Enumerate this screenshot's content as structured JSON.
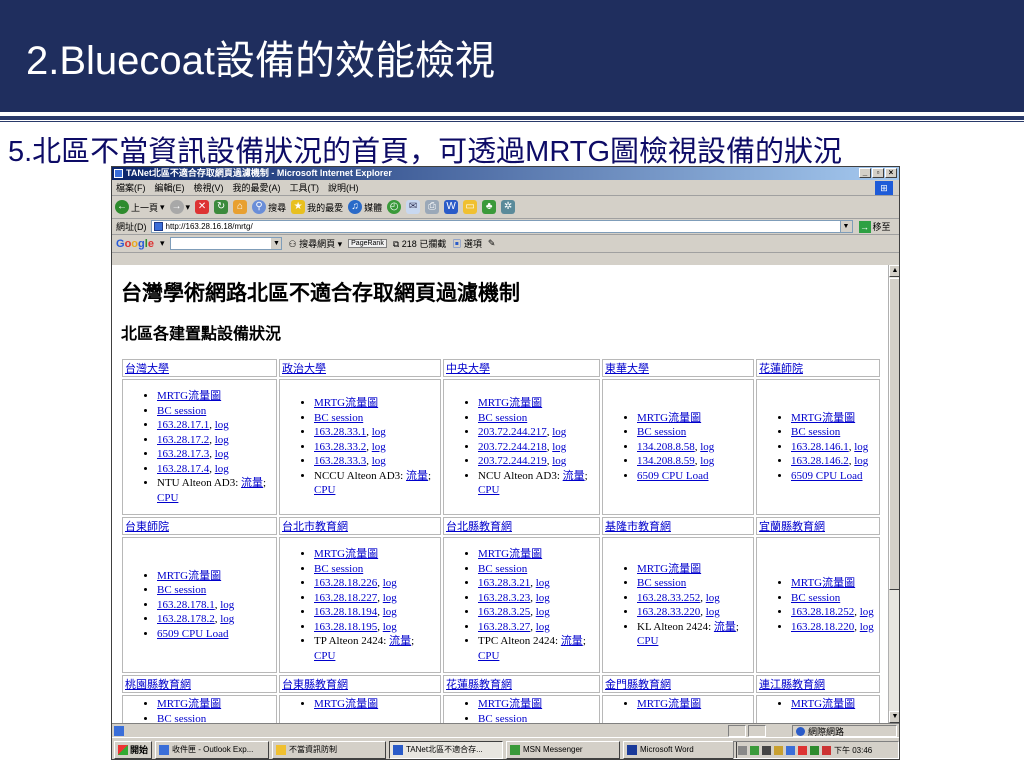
{
  "slide": {
    "title": "2.Bluecoat設備的效能檢視",
    "subtitle": "5.北區不當資訊設備狀況的首頁，可透過MRTG圖檢視設備的狀況"
  },
  "browser": {
    "window_title": "TANet北區不適合存取網頁過濾機制 - Microsoft Internet Explorer",
    "menu": [
      "檔案(F)",
      "編輯(E)",
      "檢視(V)",
      "我的最愛(A)",
      "工具(T)",
      "說明(H)"
    ],
    "toolbar": {
      "back": "上一頁",
      "search": "搜尋",
      "favorites": "我的最愛",
      "media": "媒體"
    },
    "address": {
      "label": "網址(D)",
      "url": "http://163.28.16.18/mrtg/",
      "go": "移至"
    },
    "google_bar": {
      "logo": "Google",
      "search_web": "搜尋網頁",
      "pagerank": "PageRank",
      "blocked": "218 已攔截",
      "options": "選項"
    },
    "status": {
      "zone": "網際網路"
    }
  },
  "page": {
    "h1": "台灣學術網路北區不適合存取網頁過濾機制",
    "h2": "北區各建置點設備狀況",
    "rows": [
      {
        "headers": [
          "台灣大學",
          "政治大學",
          "中央大學",
          "東華大學",
          "花蓮師院"
        ],
        "cells": [
          [
            {
              "t": "",
              "links": [
                "MRTG流量圖"
              ]
            },
            {
              "t": "",
              "links": [
                "BC session"
              ]
            },
            {
              "t": ", ",
              "links": [
                "163.28.17.1",
                "log"
              ]
            },
            {
              "t": ", ",
              "links": [
                "163.28.17.2",
                "log"
              ]
            },
            {
              "t": ", ",
              "links": [
                "163.28.17.3",
                "log"
              ]
            },
            {
              "t": ", ",
              "links": [
                "163.28.17.4",
                "log"
              ]
            },
            {
              "t": "NTU Alteon AD3: ",
              "links": [
                "流量",
                "CPU"
              ]
            }
          ],
          [
            {
              "t": "",
              "links": [
                "MRTG流量圖"
              ]
            },
            {
              "t": "",
              "links": [
                "BC session"
              ]
            },
            {
              "t": ", ",
              "links": [
                "163.28.33.1",
                "log"
              ]
            },
            {
              "t": ", ",
              "links": [
                "163.28.33.2",
                "log"
              ]
            },
            {
              "t": ", ",
              "links": [
                "163.28.33.3",
                "log"
              ]
            },
            {
              "t": "NCCU Alteon AD3: ",
              "links": [
                "流量",
                "CPU"
              ]
            }
          ],
          [
            {
              "t": "",
              "links": [
                "MRTG流量圖"
              ]
            },
            {
              "t": "",
              "links": [
                "BC session"
              ]
            },
            {
              "t": ", ",
              "links": [
                "203.72.244.217",
                "log"
              ]
            },
            {
              "t": ", ",
              "links": [
                "203.72.244.218",
                "log"
              ]
            },
            {
              "t": ", ",
              "links": [
                "203.72.244.219",
                "log"
              ]
            },
            {
              "t": "NCU Alteon AD3: ",
              "links": [
                "流量",
                "CPU"
              ]
            }
          ],
          [
            {
              "t": "",
              "links": [
                "MRTG流量圖"
              ]
            },
            {
              "t": "",
              "links": [
                "BC session"
              ]
            },
            {
              "t": ", ",
              "links": [
                "134.208.8.58",
                "log"
              ]
            },
            {
              "t": ", ",
              "links": [
                "134.208.8.59",
                "log"
              ]
            },
            {
              "t": "",
              "links": [
                "6509 CPU Load"
              ]
            }
          ],
          [
            {
              "t": "",
              "links": [
                "MRTG流量圖"
              ]
            },
            {
              "t": "",
              "links": [
                "BC session"
              ]
            },
            {
              "t": ", ",
              "links": [
                "163.28.146.1",
                "log"
              ]
            },
            {
              "t": ", ",
              "links": [
                "163.28.146.2",
                "log"
              ]
            },
            {
              "t": "",
              "links": [
                "6509 CPU Load"
              ]
            }
          ]
        ]
      },
      {
        "headers": [
          "台東師院",
          "台北市教育網",
          "台北縣教育網",
          "基隆市教育網",
          "宜蘭縣教育網"
        ],
        "cells": [
          [
            {
              "t": "",
              "links": [
                "MRTG流量圖"
              ]
            },
            {
              "t": "",
              "links": [
                "BC session"
              ]
            },
            {
              "t": ", ",
              "links": [
                "163.28.178.1",
                "log"
              ]
            },
            {
              "t": ", ",
              "links": [
                "163.28.178.2",
                "log"
              ]
            },
            {
              "t": "",
              "links": [
                "6509 CPU Load"
              ]
            }
          ],
          [
            {
              "t": "",
              "links": [
                "MRTG流量圖"
              ]
            },
            {
              "t": "",
              "links": [
                "BC session"
              ]
            },
            {
              "t": ", ",
              "links": [
                "163.28.18.226",
                "log"
              ]
            },
            {
              "t": ", ",
              "links": [
                "163.28.18.227",
                "log"
              ]
            },
            {
              "t": ", ",
              "links": [
                "163.28.18.194",
                "log"
              ]
            },
            {
              "t": ", ",
              "links": [
                "163.28.18.195",
                "log"
              ]
            },
            {
              "t": "TP Alteon 2424: ",
              "links": [
                "流量",
                "CPU"
              ]
            }
          ],
          [
            {
              "t": "",
              "links": [
                "MRTG流量圖"
              ]
            },
            {
              "t": "",
              "links": [
                "BC session"
              ]
            },
            {
              "t": ", ",
              "links": [
                "163.28.3.21",
                "log"
              ]
            },
            {
              "t": ", ",
              "links": [
                "163.28.3.23",
                "log"
              ]
            },
            {
              "t": ", ",
              "links": [
                "163.28.3.25",
                "log"
              ]
            },
            {
              "t": ", ",
              "links": [
                "163.28.3.27",
                "log"
              ]
            },
            {
              "t": "TPC Alteon 2424: ",
              "links": [
                "流量",
                "CPU"
              ]
            }
          ],
          [
            {
              "t": "",
              "links": [
                "MRTG流量圖"
              ]
            },
            {
              "t": "",
              "links": [
                "BC session"
              ]
            },
            {
              "t": ", ",
              "links": [
                "163.28.33.252",
                "log"
              ]
            },
            {
              "t": ", ",
              "links": [
                "163.28.33.220",
                "log"
              ]
            },
            {
              "t": "KL Alteon 2424: ",
              "links": [
                "流量",
                "CPU"
              ]
            }
          ],
          [
            {
              "t": "",
              "links": [
                "MRTG流量圖"
              ]
            },
            {
              "t": "",
              "links": [
                "BC session"
              ]
            },
            {
              "t": ", ",
              "links": [
                "163.28.18.252",
                "log"
              ]
            },
            {
              "t": ", ",
              "links": [
                "163.28.18.220",
                "log"
              ]
            }
          ]
        ]
      },
      {
        "headers": [
          "桃園縣教育網",
          "台東縣教育網",
          "花蓮縣教育網",
          "金門縣教育網",
          "連江縣教育網"
        ],
        "cells": [
          [
            {
              "t": "",
              "links": [
                "MRTG流量圖"
              ]
            },
            {
              "t": "",
              "links": [
                "BC session"
              ]
            }
          ],
          [
            {
              "t": "",
              "links": [
                "MRTG流量圖"
              ]
            }
          ],
          [
            {
              "t": "",
              "links": [
                "MRTG流量圖"
              ]
            },
            {
              "t": "",
              "links": [
                "BC session"
              ]
            }
          ],
          [
            {
              "t": "",
              "links": [
                "MRTG流量圖"
              ]
            }
          ],
          [
            {
              "t": "",
              "links": [
                "MRTG流量圖"
              ]
            }
          ]
        ]
      }
    ]
  },
  "taskbar": {
    "start": "開始",
    "tasks": [
      "收件匣 - Outlook Exp...",
      "不當資訊防制",
      "TANet北區不適合存...",
      "MSN Messenger",
      "Microsoft Word"
    ],
    "active_index": 2,
    "clock": "下午 03:46"
  },
  "colors": {
    "slide_header": "#1f2e5e",
    "subtitle_text": "#0d0b66",
    "link": "#0000cc",
    "ie_titlebar": "#0a246a"
  }
}
